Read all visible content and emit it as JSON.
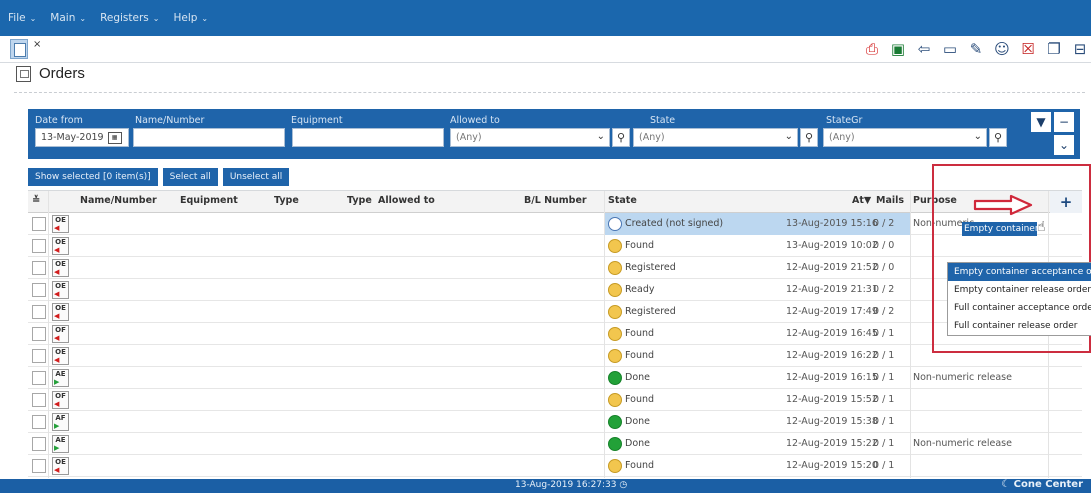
{
  "menu": [
    {
      "label": "File"
    },
    {
      "label": "Main"
    },
    {
      "label": "Registers"
    },
    {
      "label": "Help"
    }
  ],
  "tab_close": "×",
  "page": {
    "title": "Orders"
  },
  "filters": {
    "date_from_label": "Date from",
    "date_from_value": "13-May-2019",
    "name_label": "Name/Number",
    "equipment_label": "Equipment",
    "allowed_label": "Allowed to",
    "allowed_value": "(Any)",
    "state_label": "State",
    "state_value": "(Any)",
    "stategr_label": "StateGr",
    "stategr_value": "(Any)"
  },
  "buttons": {
    "show_selected": "Show selected [0 item(s)]",
    "select_all": "Select all",
    "unselect_all": "Unselect all"
  },
  "columns": {
    "name": "Name/Number",
    "equipment": "Equipment",
    "type1": "Type",
    "type2": "Type",
    "allowed": "Allowed to",
    "bl": "B/L Number",
    "state": "State",
    "at": "At▼",
    "mails": "Mails",
    "purpose": "Purpose"
  },
  "rows": [
    {
      "code": "OE",
      "arrow": "red",
      "state": "Created (not signed)",
      "status": "created",
      "at": "13-Aug-2019 15:16",
      "mails": "0 / 2",
      "purpose": "Non-numeric"
    },
    {
      "code": "OE",
      "arrow": "red",
      "state": "Found",
      "status": "yellow",
      "at": "13-Aug-2019 10:02",
      "mails": "0 / 0",
      "purpose": ""
    },
    {
      "code": "OE",
      "arrow": "red",
      "state": "Registered",
      "status": "yellow",
      "at": "12-Aug-2019 21:52",
      "mails": "0 / 0",
      "purpose": ""
    },
    {
      "code": "OE",
      "arrow": "red",
      "state": "Ready",
      "status": "yellow",
      "at": "12-Aug-2019 21:31",
      "mails": "0 / 2",
      "purpose": ""
    },
    {
      "code": "OE",
      "arrow": "red",
      "state": "Registered",
      "status": "yellow",
      "at": "12-Aug-2019 17:49",
      "mails": "0 / 2",
      "purpose": ""
    },
    {
      "code": "OF",
      "arrow": "red",
      "state": "Found",
      "status": "yellow",
      "at": "12-Aug-2019 16:45",
      "mails": "0 / 1",
      "purpose": ""
    },
    {
      "code": "OE",
      "arrow": "red",
      "state": "Found",
      "status": "yellow",
      "at": "12-Aug-2019 16:22",
      "mails": "0 / 1",
      "purpose": ""
    },
    {
      "code": "AE",
      "arrow": "green",
      "state": "Done",
      "status": "done",
      "at": "12-Aug-2019 16:15",
      "mails": "0 / 1",
      "purpose": "Non-numeric release"
    },
    {
      "code": "OF",
      "arrow": "red",
      "state": "Found",
      "status": "yellow",
      "at": "12-Aug-2019 15:52",
      "mails": "0 / 1",
      "purpose": ""
    },
    {
      "code": "AF",
      "arrow": "green",
      "state": "Done",
      "status": "done",
      "at": "12-Aug-2019 15:38",
      "mails": "0 / 1",
      "purpose": ""
    },
    {
      "code": "AE",
      "arrow": "green",
      "state": "Done",
      "status": "done",
      "at": "12-Aug-2019 15:22",
      "mails": "0 / 1",
      "purpose": "Non-numeric release"
    },
    {
      "code": "OE",
      "arrow": "red",
      "state": "Found",
      "status": "yellow",
      "at": "12-Aug-2019 15:20",
      "mails": "0 / 1",
      "purpose": ""
    }
  ],
  "popup": {
    "tooltip": "Empty container acce",
    "items": [
      "Empty container acceptance order",
      "Empty container release order",
      "Full container acceptance order",
      "Full container release order"
    ]
  },
  "status": {
    "time": "13-Aug-2019 16:27:33",
    "brand": "Cone Center"
  },
  "colors": {
    "menu_bg": "#1b67ad",
    "panel_bg": "#1f64aa",
    "highlight": "#cc2d3f",
    "found": "#f2c64e",
    "done": "#22a138"
  }
}
